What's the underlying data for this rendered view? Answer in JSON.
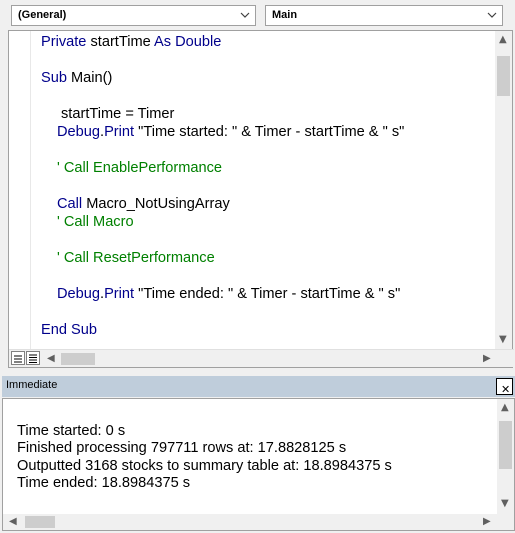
{
  "object_combo": {
    "value": "(General)"
  },
  "procedure_combo": {
    "value": "Main"
  },
  "code_lines": [
    {
      "kw1": "Private",
      "mid": " startTime ",
      "kw2": "As Double",
      "tail": ""
    },
    {
      "kw1": "Sub",
      "mid": " Main()",
      "kw2": "",
      "tail": ""
    },
    {
      "text": "startTime = Timer"
    },
    {
      "kw1": "Debug",
      "mid": ".",
      "kw2": "Print",
      "tail": " \"Time started: \" & Timer - startTime & \" s\""
    },
    {
      "comment": "' Call EnablePerformance"
    },
    {
      "kw1": "Call",
      "mid": " Macro_NotUsingArray",
      "kw2": "",
      "tail": ""
    },
    {
      "comment": "' Call Macro"
    },
    {
      "comment": "' Call ResetPerformance"
    },
    {
      "kw1": "Debug",
      "mid": ".",
      "kw2": "Print",
      "tail": " \"Time ended: \" & Timer - startTime & \" s\""
    },
    {
      "kw1": "End Sub",
      "mid": "",
      "kw2": "",
      "tail": ""
    }
  ],
  "immediate": {
    "title": "Immediate",
    "close_label": "✕",
    "lines": [
      "Time started: 0 s",
      "Finished processing 797711 rows at: 17.8828125 s",
      "Outputted 3168 stocks to summary table at: 18.8984375 s",
      "Time ended: 18.8984375 s"
    ]
  },
  "colors": {
    "keyword": "#00008b",
    "comment": "#008000",
    "title_bar": "#bfcddb"
  }
}
